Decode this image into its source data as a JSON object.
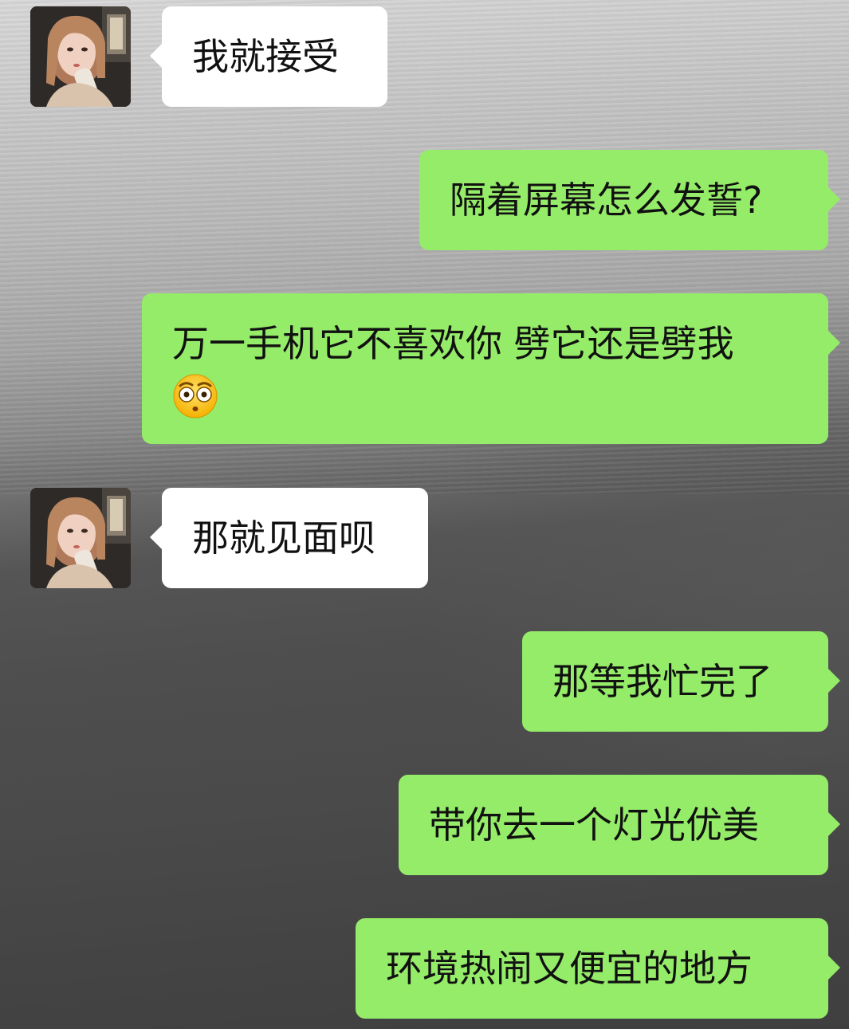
{
  "messages": [
    {
      "side": "left",
      "text": "我就接受",
      "avatar": "girl-portrait"
    },
    {
      "side": "right",
      "text": "隔着屏幕怎么发誓?"
    },
    {
      "side": "right",
      "text": "万一手机它不喜欢你 劈它还是劈我",
      "emoji": "flushed-face-emoji"
    },
    {
      "side": "left",
      "text": "那就见面呗",
      "avatar": "girl-portrait"
    },
    {
      "side": "right",
      "text": "那等我忙完了"
    },
    {
      "side": "right",
      "text": "带你去一个灯光优美"
    },
    {
      "side": "right",
      "text": "环境热闹又便宜的地方"
    }
  ],
  "colors": {
    "incoming_bubble": "#ffffff",
    "outgoing_bubble": "#95ec69",
    "text": "#111111"
  }
}
